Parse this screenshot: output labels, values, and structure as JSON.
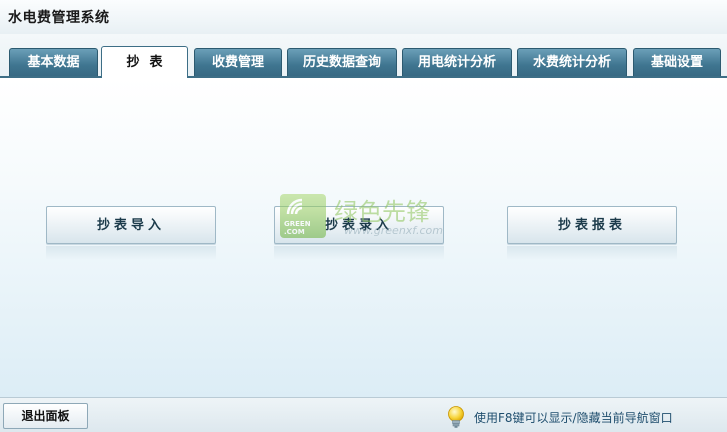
{
  "app": {
    "title": "水电费管理系统"
  },
  "tabs": [
    {
      "label": "基本数据",
      "active": false
    },
    {
      "label": "抄表",
      "active": true
    },
    {
      "label": "收费管理",
      "active": false
    },
    {
      "label": "历史数据查询",
      "active": false
    },
    {
      "label": "用电统计分析",
      "active": false
    },
    {
      "label": "水费统计分析",
      "active": false
    },
    {
      "label": "基础设置",
      "active": false
    }
  ],
  "main": {
    "buttons": [
      {
        "label": "抄表导入"
      },
      {
        "label": "抄表录入"
      },
      {
        "label": "抄表报表"
      }
    ]
  },
  "watermark": {
    "logo_text": "GREEN .COM",
    "name": "绿色先锋",
    "url": "www.greenxf.com"
  },
  "status_bar": {
    "exit_label": "退出面板",
    "hint": "使用F8键可以显示/隐藏当前导航窗口",
    "hint_icon": "lightbulb-icon"
  },
  "colors": {
    "tab_fill": "#3f7590",
    "tab_border": "#2c5a70",
    "active_tab_fill": "#ffffff",
    "hint_text": "#1f4e6e"
  }
}
